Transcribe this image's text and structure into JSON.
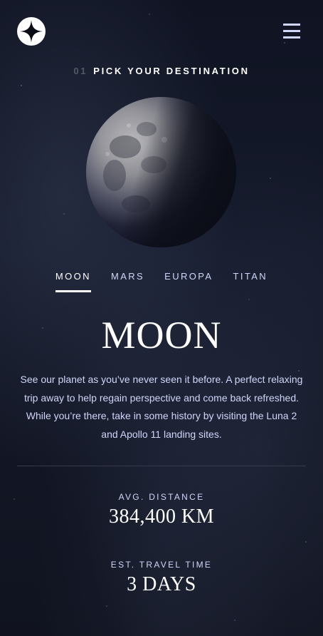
{
  "header": {
    "logo_icon": "four-point-star-logo-icon",
    "menu_icon": "hamburger-menu-icon"
  },
  "page_title": {
    "number": "01",
    "text": "PICK YOUR DESTINATION"
  },
  "tabs": [
    {
      "label": "MOON",
      "active": true
    },
    {
      "label": "MARS",
      "active": false
    },
    {
      "label": "EUROPA",
      "active": false
    },
    {
      "label": "TITAN",
      "active": false
    }
  ],
  "destination": {
    "name": "MOON",
    "description": "See our planet as you’ve never seen it before. A perfect relaxing trip away to help regain perspective and come back refreshed. While you’re there, take in some history by visiting the Luna 2 and Apollo 11 landing sites."
  },
  "stats": {
    "distance_label": "AVG. DISTANCE",
    "distance_value": "384,400 KM",
    "travel_label": "EST. TRAVEL TIME",
    "travel_value": "3 DAYS"
  },
  "colors": {
    "background": "#0b0d17",
    "text_light": "#d0d6f9",
    "white": "#ffffff",
    "divider": "#383b4b"
  }
}
